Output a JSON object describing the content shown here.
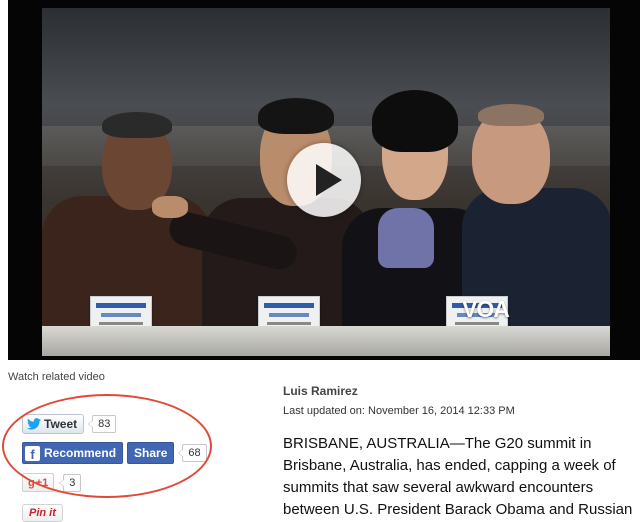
{
  "video": {
    "watermark": "VOA",
    "play_icon": "play-icon"
  },
  "related_video_link": "Watch related video",
  "social": {
    "tweet_label": "Tweet",
    "tweet_count": "83",
    "recommend_label": "Recommend",
    "share_label": "Share",
    "facebook_count": "68",
    "gplus_label": "+1",
    "gplus_count": "3",
    "pin_label": "Pin it",
    "highlight_color": "#e14a38"
  },
  "article": {
    "author": "Luis Ramirez",
    "updated": "Last updated on: November 16, 2014 12:33 PM",
    "body": "BRISBANE, AUSTRALIA—The G20 summit in Brisbane, Australia, has ended, capping a week of summits that saw several awkward encounters between U.S. President Barack Obama and Russian"
  },
  "colors": {
    "facebook": "#4267b2",
    "twitter": "#1da1f2",
    "gplus": "#dd4b39",
    "pinterest": "#cb2027"
  }
}
